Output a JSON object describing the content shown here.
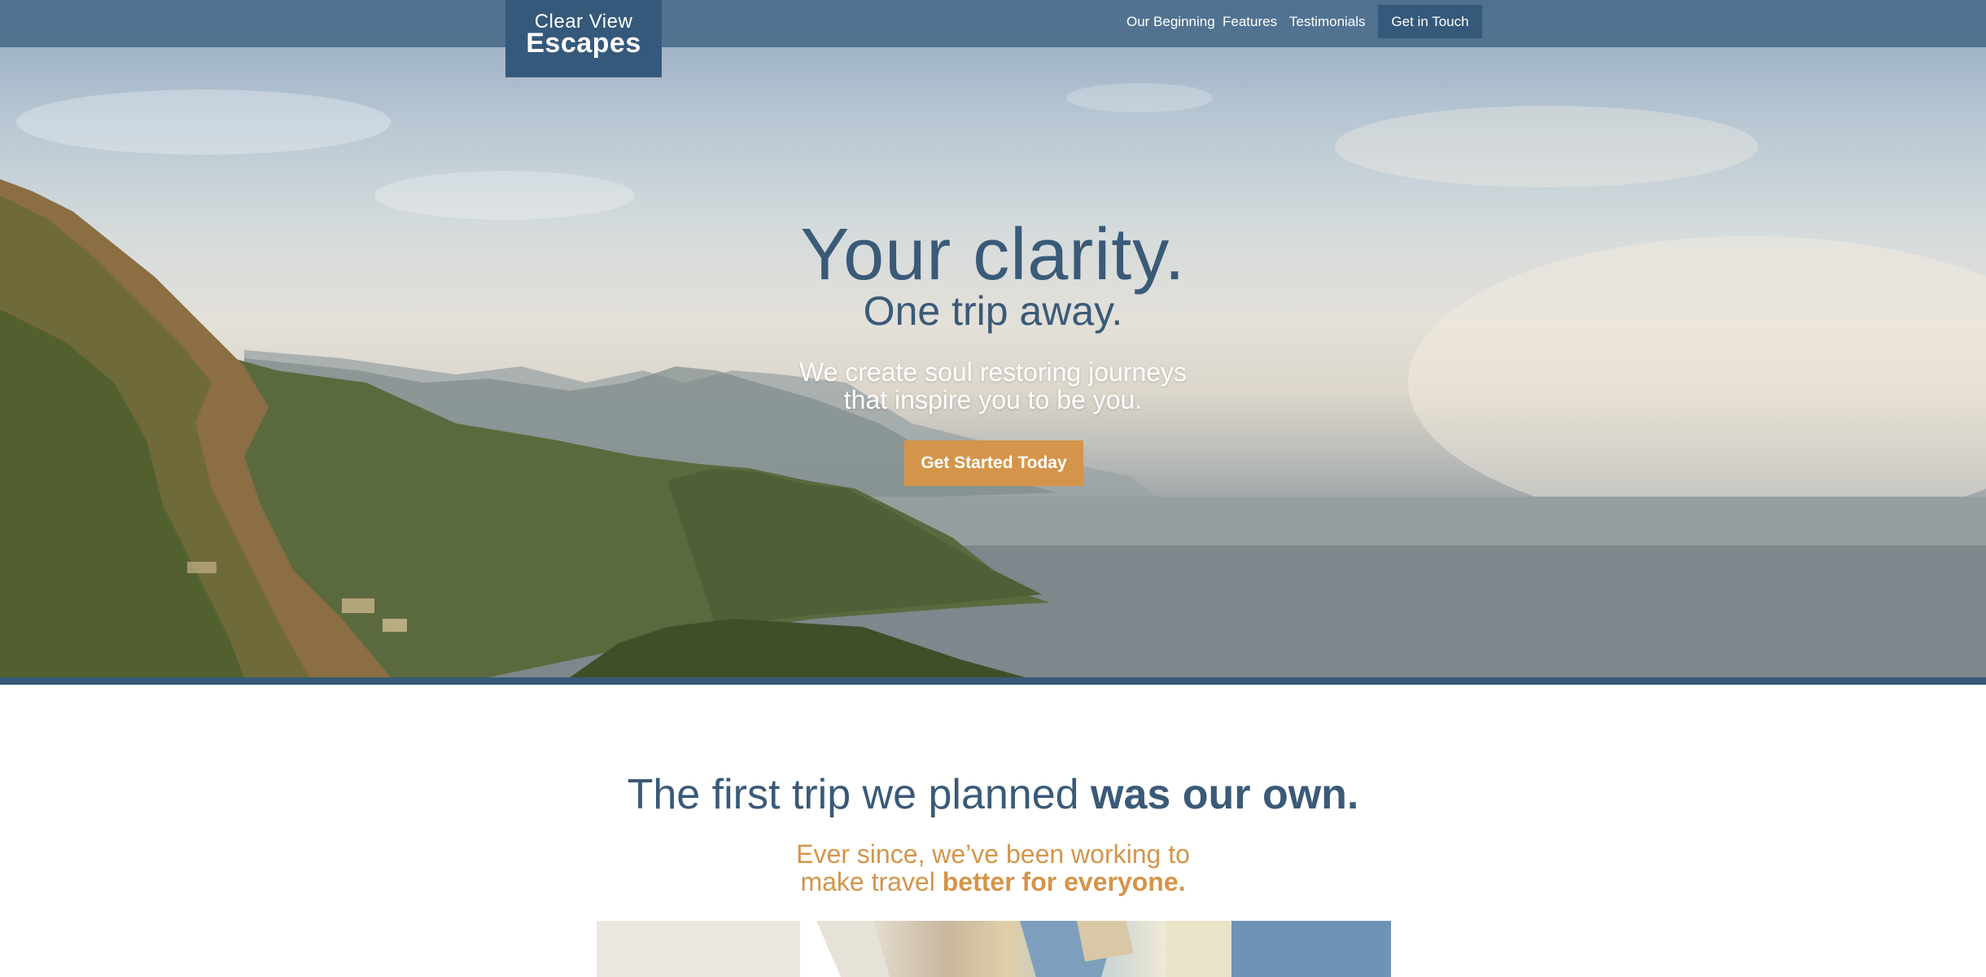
{
  "nav": {
    "logo_line1": "Clear View",
    "logo_line2": "Escapes",
    "links": [
      "Our Beginning",
      "Features",
      "Testimonials"
    ],
    "cta": "Get in Touch"
  },
  "hero": {
    "title": "Your clarity.",
    "subtitle": "One trip away.",
    "description_line1": "We create soul restoring journeys",
    "description_line2": "that inspire you to be you.",
    "button": "Get Started Today"
  },
  "section2": {
    "title_light": "The first trip we planned",
    "title_bold": "was our own.",
    "sub_line1": "Ever since, we’ve been working to",
    "sub_line2_light": "make travel",
    "sub_line2_bold": "better for everyone."
  },
  "colors": {
    "brand_blue": "#35597a",
    "accent_orange": "#d4954a",
    "title_blue": "#3a5a78"
  }
}
